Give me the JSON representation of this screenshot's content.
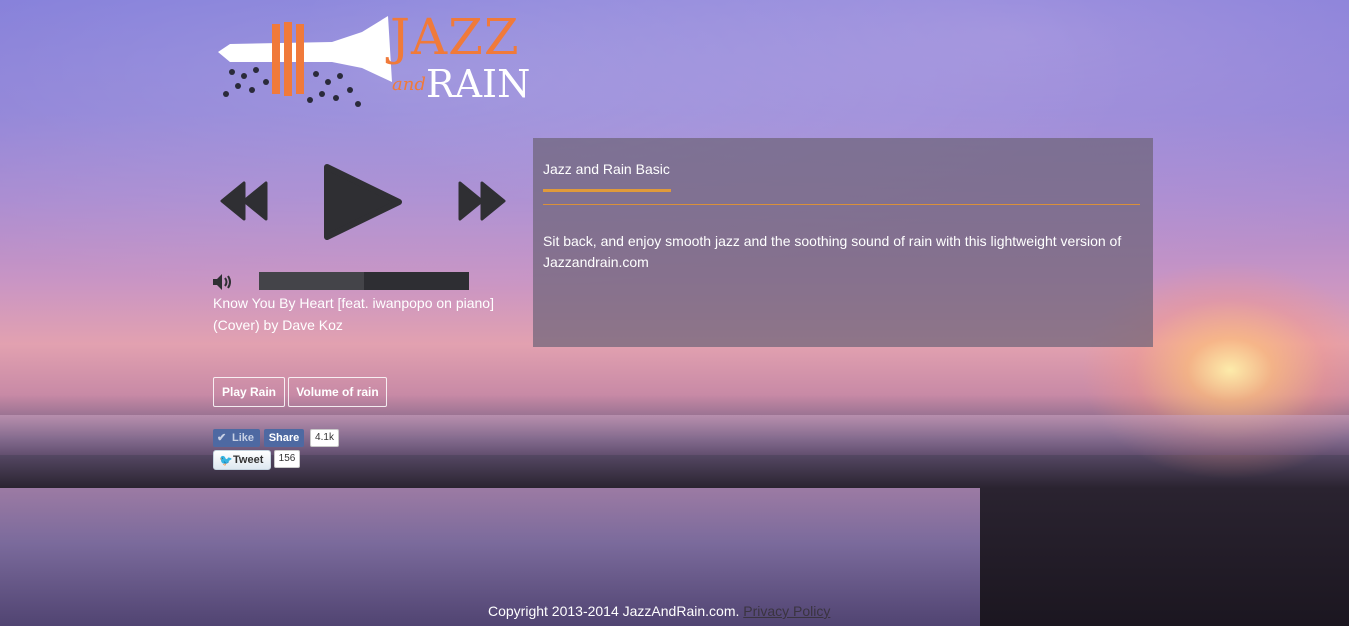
{
  "logo": {
    "word_jazz": "JAZZ",
    "word_and": "and",
    "word_rain": "RAIN",
    "accent_color": "#f07a3a"
  },
  "player": {
    "rewind_icon": "rewind-icon",
    "play_icon": "play-icon",
    "forward_icon": "fast-forward-icon",
    "volume_icon": "speaker-icon",
    "volume_level": 0.5,
    "track_title": "Know You By Heart [feat. iwanpopo on piano] (Cover) by Dave Koz"
  },
  "panel": {
    "tab_label": "Jazz and Rain Basic",
    "description": "Sit back, and enjoy smooth jazz and the soothing sound of rain with this lightweight version of Jazzandrain.com",
    "accent_color": "#e09a3a"
  },
  "buttons": {
    "play_rain": "Play Rain",
    "volume_rain": "Volume of rain"
  },
  "social": {
    "like_label": "Like",
    "share_label": "Share",
    "fb_count": "4.1k",
    "tweet_label": "Tweet",
    "tweet_count": "156"
  },
  "footer": {
    "copyright": "Copyright 2013-2014 JazzAndRain.com.",
    "privacy_link": "Privacy Policy"
  }
}
